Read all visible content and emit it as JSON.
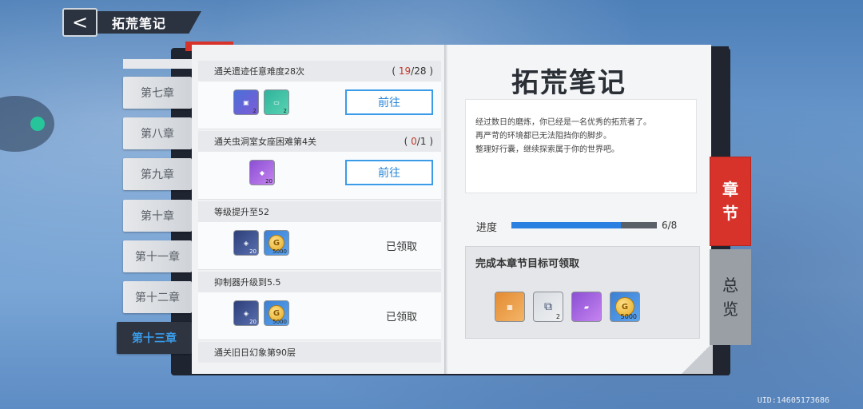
{
  "header": {
    "back_label": "<",
    "title": "拓荒笔记"
  },
  "chapters": [
    {
      "label": "第七章"
    },
    {
      "label": "第八章"
    },
    {
      "label": "第九章"
    },
    {
      "label": "第十章"
    },
    {
      "label": "第十一章"
    },
    {
      "label": "第十二章"
    },
    {
      "label": "第十三章"
    }
  ],
  "active_chapter": "第十三章",
  "tasks": [
    {
      "title": "通关遗迹任意难度28次",
      "prog_open": "(",
      "prog_cur": "19",
      "prog_sep": "/28",
      "prog_close": ")",
      "items": [
        {
          "icon": "cube-crate",
          "count": "2"
        },
        {
          "icon": "cartridge",
          "count": "2"
        }
      ],
      "action": "前往"
    },
    {
      "title": "通关虫洞室女座困难第4关",
      "prog_open": "(",
      "prog_cur": "0",
      "prog_sep": "/1",
      "prog_close": ")",
      "items": [
        {
          "icon": "purple-gem",
          "count": "20"
        }
      ],
      "action": "前往"
    },
    {
      "title": "等级提升至52",
      "items": [
        {
          "icon": "dark-cube",
          "count": "20"
        },
        {
          "icon": "gold-coin",
          "count": "5000"
        }
      ],
      "status": "已领取"
    },
    {
      "title": "抑制器升级到5.5",
      "items": [
        {
          "icon": "dark-cube",
          "count": "20"
        },
        {
          "icon": "gold-coin",
          "count": "5000"
        }
      ],
      "status": "已领取"
    },
    {
      "title": "通关旧日幻象第90层"
    }
  ],
  "right_page": {
    "title": "拓荒笔记",
    "desc_line1": "经过数日的磨炼，你已经是一名优秀的拓荒者了。",
    "desc_line2": "再严苛的环境都已无法阻挡你的脚步。",
    "desc_line3": "整理好行囊，继续探索属于你的世界吧。",
    "progress_label": "进度",
    "progress_value": "6/8",
    "progress_fraction": 0.75,
    "reward_title": "完成本章节目标可领取",
    "rewards": [
      {
        "icon": "orange-box",
        "count": ""
      },
      {
        "icon": "cartridge-pack",
        "count": "2"
      },
      {
        "icon": "purple-ticket",
        "count": ""
      },
      {
        "icon": "gold-coin",
        "count": "5000"
      }
    ]
  },
  "side_tabs": {
    "chapter_1": "章",
    "chapter_2": "节",
    "overview_1": "总",
    "overview_2": "览"
  },
  "uid": "UID:14605173686",
  "colors": {
    "accent_blue": "#3a9be8",
    "accent_red": "#d8332b",
    "dark": "#2c3340"
  }
}
